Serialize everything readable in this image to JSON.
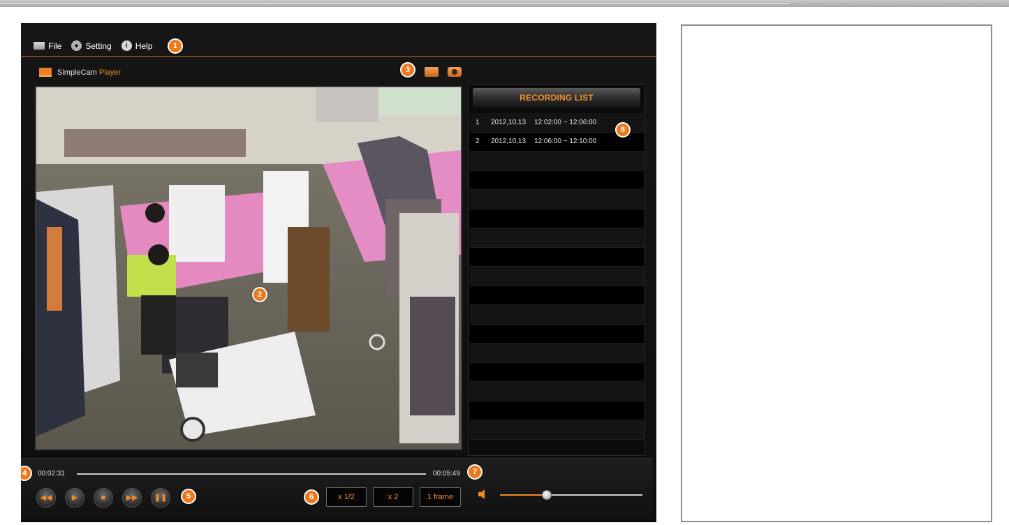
{
  "menu": {
    "file": "File",
    "setting": "Setting",
    "help": "Help"
  },
  "brand": {
    "name": "SimpleCam",
    "suffix": "Player"
  },
  "recording_list": {
    "title": "RECORDING LIST",
    "items": [
      {
        "index": "1",
        "date": "2012,10,13",
        "range": "12:02:00 ~ 12:06:00"
      },
      {
        "index": "2",
        "date": "2012,10,13",
        "range": "12:06:00 ~ 12:10:00"
      }
    ]
  },
  "playback": {
    "current_time": "00:02:31",
    "total_time": "00:05:49",
    "progress": 0.0
  },
  "speed_buttons": [
    "x 1/2",
    "x 2",
    "1 frame"
  ],
  "volume": {
    "level": 0.33
  },
  "badges": [
    "1",
    "2",
    "3",
    "4",
    "5",
    "6",
    "7",
    "8"
  ],
  "colors": {
    "accent": "#f08a22",
    "badge": "#ec7a1c",
    "background": "#111111"
  },
  "icons": {
    "menu": [
      "folder-icon",
      "gear-icon",
      "help-icon"
    ],
    "toolbar": [
      "record-folder-icon",
      "camera-icon"
    ],
    "player": [
      "rewind-icon",
      "play-icon",
      "stop-icon",
      "fast-forward-icon",
      "pause-icon",
      "speaker-icon"
    ]
  }
}
